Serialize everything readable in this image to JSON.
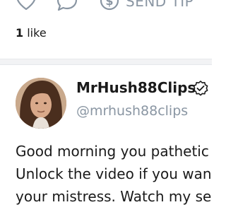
{
  "post_actions": {
    "like_icon": "heart-icon",
    "comment_icon": "comment-icon",
    "tip_icon": "dollar-icon",
    "tip_label": "SEND TIP"
  },
  "likes": {
    "count": "1",
    "label": "like"
  },
  "author": {
    "display_name": "MrHush88Clips",
    "handle": "@mrhush88clips",
    "verified_icon": "verified-badge-icon"
  },
  "post": {
    "lines": [
      "Good morning you pathetic",
      "Unlock the video if you want",
      "your mistress. Watch my se"
    ]
  },
  "colors": {
    "text": "#1a1a1a",
    "muted": "#8a96a3",
    "divider_bg": "#f2f3f5"
  }
}
